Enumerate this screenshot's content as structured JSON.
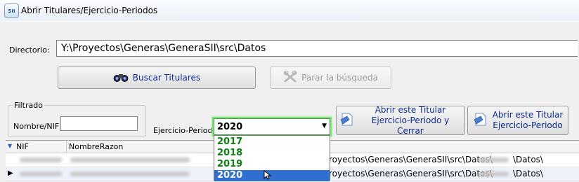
{
  "window": {
    "app_icon_text": "SII",
    "title": "Abrir Titulares/Ejercicio-Periodos"
  },
  "directory": {
    "label": "Directorio:",
    "value": "Y:\\Proyectos\\Generas\\GeneraSII\\src\\Datos"
  },
  "buttons": {
    "search": "Buscar Titulares",
    "stop": "Parar la búsqueda",
    "open_close": "Abrir este Titular\nEjercicio-Periodo y Cerrar",
    "open": "Abrir este Titular\nEjercicio-Periodo"
  },
  "filter": {
    "group_title": "Filtrado",
    "nif_label": "Nombre/NIF",
    "nif_value": ""
  },
  "period": {
    "label": "Ejercicio-Periodo",
    "selected": "2020",
    "options": [
      "2017",
      "2018",
      "2019",
      "2020"
    ],
    "option_color": "#0f7d10",
    "highlight_color": "#2f6fd0"
  },
  "grid": {
    "columns": [
      "NIF",
      "NombreRazon"
    ],
    "rows": [
      {
        "path_prefix": "royectos\\Generas\\GeneraSII\\src\\Datos\\",
        "path_suffix": "\\Datos\\"
      },
      {
        "path_prefix": "royectos\\Generas\\GeneraSII\\src\\Datos\\",
        "path_suffix": "\\Datos\\"
      }
    ]
  }
}
